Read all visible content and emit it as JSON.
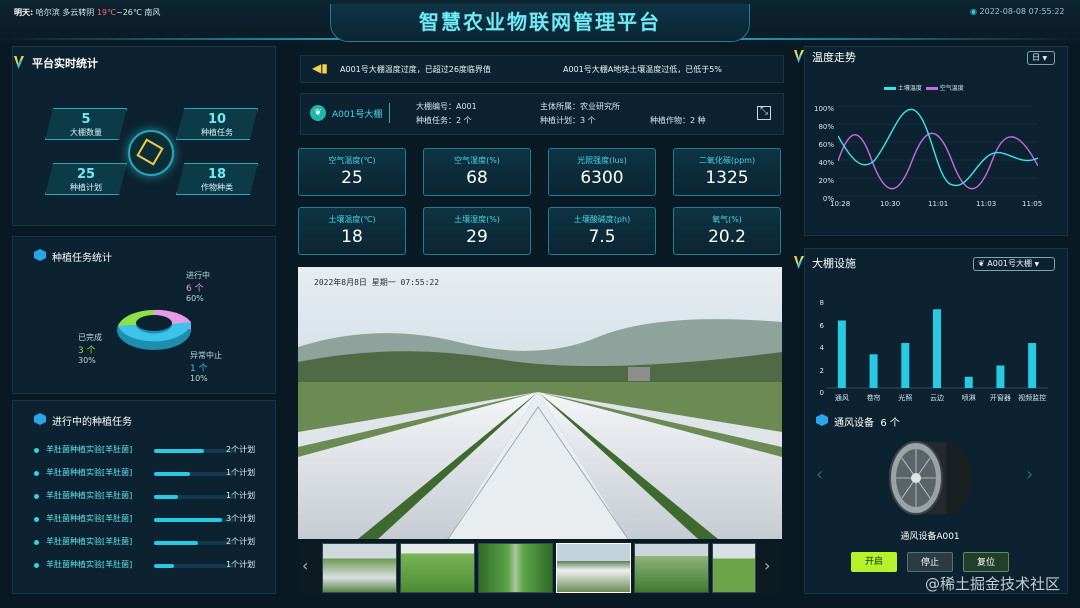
{
  "header": {
    "title": "智慧农业物联网管理平台",
    "weather_label": "明天:",
    "weather_text": "哈尔滨 多云转阴",
    "weather_temp_hi": "19℃",
    "weather_temp_lo": "~26℃ 南风",
    "datetime": "2022-08-08 07:55:22"
  },
  "stats": {
    "title": "平台实时统计",
    "items": [
      {
        "value": "5",
        "label": "大棚数量"
      },
      {
        "value": "10",
        "label": "种植任务"
      },
      {
        "value": "25",
        "label": "种植计划"
      },
      {
        "value": "18",
        "label": "作物种类"
      }
    ]
  },
  "task_stats": {
    "title": "种植任务统计",
    "in_progress": {
      "label": "进行中",
      "count": "6 个",
      "pct": "60%"
    },
    "done": {
      "label": "已完成",
      "count": "3 个",
      "pct": "30%"
    },
    "abnormal": {
      "label": "异常中止",
      "count": "1 个",
      "pct": "10%"
    }
  },
  "running_tasks": {
    "title": "进行中的种植任务",
    "rows": [
      {
        "name": "羊肚菌种植实验[羊肚菌]",
        "count": "2个计划",
        "progress": 0.62
      },
      {
        "name": "羊肚菌种植实验[羊肚菌]",
        "count": "1个计划",
        "progress": 0.45
      },
      {
        "name": "羊肚菌种植实验[羊肚菌]",
        "count": "1个计划",
        "progress": 0.3
      },
      {
        "name": "羊肚菌种植实验[羊肚菌]",
        "count": "3个计划",
        "progress": 0.85
      },
      {
        "name": "羊肚菌种植实验[羊肚菌]",
        "count": "2个计划",
        "progress": 0.55
      },
      {
        "name": "羊肚菌种植实验[羊肚菌]",
        "count": "1个计划",
        "progress": 0.25
      }
    ]
  },
  "alerts": {
    "a1": "A001号大棚温度过度，已超过26度临界值",
    "a2": "A001号大棚A地块土壤温度过低，已低于5%"
  },
  "greenhouse_info": {
    "badge": "A001号大棚",
    "num": "大棚编号：A001",
    "owner": "主体所属：农业研究所",
    "tasks": "种植任务：2 个",
    "plans": "种植计划：3 个",
    "crops": "种植作物：2 种"
  },
  "sensors": [
    {
      "label": "空气温度(℃)",
      "value": "25"
    },
    {
      "label": "空气湿度(%)",
      "value": "68"
    },
    {
      "label": "光照强度(lus)",
      "value": "6300"
    },
    {
      "label": "二氧化碳(ppm)",
      "value": "1325"
    },
    {
      "label": "土壤温度(℃)",
      "value": "18"
    },
    {
      "label": "土壤湿度(%)",
      "value": "29"
    },
    {
      "label": "土壤酸碱度(ph)",
      "value": "7.5"
    },
    {
      "label": "氧气(%)",
      "value": "20.2"
    }
  ],
  "camera": {
    "timestamp": "2022年8月8日  星期一  07:55:22"
  },
  "temp_trend": {
    "title": "温度走势",
    "period": "日",
    "legend": [
      "土壤温度",
      "空气温度"
    ],
    "y_ticks": [
      "100%",
      "80%",
      "60%",
      "40%",
      "20%",
      "0%"
    ],
    "x_ticks": [
      "10:28",
      "10:30",
      "11:01",
      "11:03",
      "11:05"
    ]
  },
  "facilities": {
    "title": "大棚设施",
    "selected": "A001号大棚",
    "y_ticks": [
      "8",
      "6",
      "4",
      "2",
      "0"
    ]
  },
  "chart_data": {
    "type": "bar",
    "categories": [
      "通风",
      "卷帘",
      "光照",
      "云边",
      "喷淋",
      "开窗器",
      "视频监控"
    ],
    "values": [
      6,
      3,
      4,
      7,
      1,
      2,
      4
    ],
    "ylim": [
      0,
      8
    ],
    "grid": false,
    "color": "#27c9e3"
  },
  "device": {
    "title": "通风设备",
    "count": "6 个",
    "name": "通风设备A001",
    "btn_on": "开启",
    "btn_stop": "停止",
    "btn_reset": "复位"
  },
  "watermark": "@稀土掘金技术社区"
}
